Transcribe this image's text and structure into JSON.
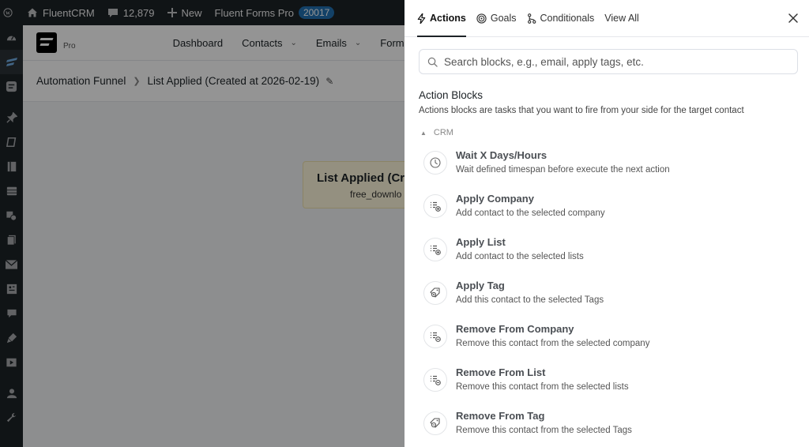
{
  "adminbar": {
    "site_name": "FluentCRM",
    "comments_count": "12,879",
    "new_label": "New",
    "forms_label": "Fluent Forms Pro",
    "forms_badge": "20017"
  },
  "plugin": {
    "pro_label": "Pro",
    "nav": [
      {
        "label": "Dashboard"
      },
      {
        "label": "Contacts"
      },
      {
        "label": "Emails"
      },
      {
        "label": "Form"
      }
    ],
    "breadcrumb": {
      "root": "Automation Funnel",
      "current": "List Applied (Created at 2026-02-19)"
    },
    "trigger": {
      "title": "List Applied (Cre",
      "subtitle": "free_downlo"
    }
  },
  "drawer": {
    "tabs": [
      {
        "label": "Actions",
        "icon": "bolt-icon"
      },
      {
        "label": "Goals",
        "icon": "target-icon"
      },
      {
        "label": "Conditionals",
        "icon": "branch-icon"
      },
      {
        "label": "View All",
        "icon": ""
      }
    ],
    "search_placeholder": "Search blocks, e.g., email, apply tags, etc.",
    "section_title": "Action Blocks",
    "section_desc": "Actions blocks are tasks that you want to fire from your side for the target contact",
    "group_label": "CRM",
    "blocks": [
      {
        "title": "Wait X Days/Hours",
        "desc": "Wait defined timespan before execute the next action",
        "icon": "clock-icon"
      },
      {
        "title": "Apply Company",
        "desc": "Add contact to the selected company",
        "icon": "list-plus-icon"
      },
      {
        "title": "Apply List",
        "desc": "Add contact to the selected lists",
        "icon": "list-plus-icon"
      },
      {
        "title": "Apply Tag",
        "desc": "Add this contact to the selected Tags",
        "icon": "tag-plus-icon"
      },
      {
        "title": "Remove From Company",
        "desc": "Remove this contact from the selected company",
        "icon": "list-minus-icon"
      },
      {
        "title": "Remove From List",
        "desc": "Remove this contact from the selected lists",
        "icon": "list-minus-icon"
      },
      {
        "title": "Remove From Tag",
        "desc": "Remove this contact from the selected Tags",
        "icon": "tag-minus-icon"
      }
    ]
  }
}
